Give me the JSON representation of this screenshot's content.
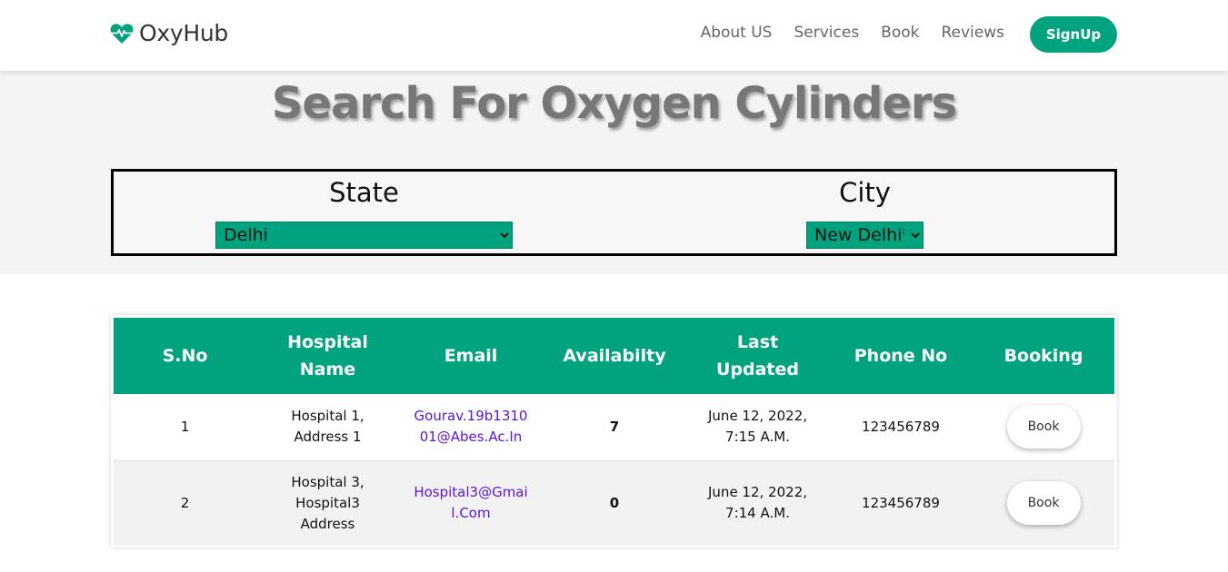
{
  "nav": {
    "brand": "OxyHub",
    "brand_icon": "heart-pulse-icon",
    "links": [
      "About US",
      "Services",
      "Book",
      "Reviews"
    ],
    "signup_label": "SignUp"
  },
  "colors": {
    "accent": "#00a37d",
    "link": "#5a14d8"
  },
  "search": {
    "title": "Search For Oxygen Cylinders",
    "state_label": "State",
    "state_value": "Delhi",
    "city_label": "City",
    "city_value": "New Delhi*"
  },
  "table": {
    "headers": [
      "S.No",
      "Hospital Name",
      "Email",
      "Availabilty",
      "Last Updated",
      "Phone No",
      "Booking"
    ],
    "rows": [
      {
        "sno": "1",
        "hospital_name": "Hospital 1, Address 1",
        "email": "Gourav.19b131001@Abes.Ac.In",
        "availability": "7",
        "last_updated": "June 12, 2022, 7:15 A.M.",
        "phone": "123456789",
        "book_label": "Book"
      },
      {
        "sno": "2",
        "hospital_name": "Hospital 3, Hospital3 Address",
        "email": "Hospital3@Gmail.Com",
        "availability": "0",
        "last_updated": "June 12, 2022, 7:14 A.M.",
        "phone": "123456789",
        "book_label": "Book"
      }
    ]
  }
}
